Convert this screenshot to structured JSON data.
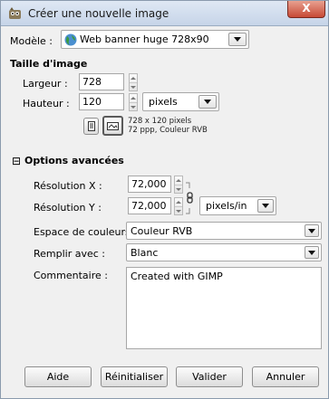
{
  "window": {
    "title": "Créer une nouvelle image",
    "close": "X"
  },
  "template": {
    "label": "Modèle :",
    "value": "Web banner huge 728x90"
  },
  "image_size": {
    "heading": "Taille d'image",
    "width_label": "Largeur :",
    "width_value": "728",
    "height_label": "Hauteur :",
    "height_value": "120",
    "unit": "pixels",
    "info_line1": "728 x 120 pixels",
    "info_line2": "72 ppp, Couleur RVB"
  },
  "advanced": {
    "expander_symbol": "⊟",
    "heading": "Options avancées",
    "res_x_label": "Résolution X :",
    "res_x_value": "72,000",
    "res_y_label": "Résolution Y :",
    "res_y_value": "72,000",
    "res_unit": "pixels/in",
    "colorspace_label": "Espace de couleurs :",
    "colorspace_value": "Couleur RVB",
    "fill_label": "Remplir avec :",
    "fill_value": "Blanc",
    "comment_label": "Commentaire :",
    "comment_value": "Created with GIMP"
  },
  "buttons": {
    "help": "Aide",
    "reset": "Réinitialiser",
    "ok": "Valider",
    "cancel": "Annuler"
  },
  "colors": {
    "titlebar_top": "#dfe8f4",
    "close_red": "#c74a36",
    "dialog_bg": "#f0f0f0",
    "globe_green": "#3c9a3c"
  }
}
